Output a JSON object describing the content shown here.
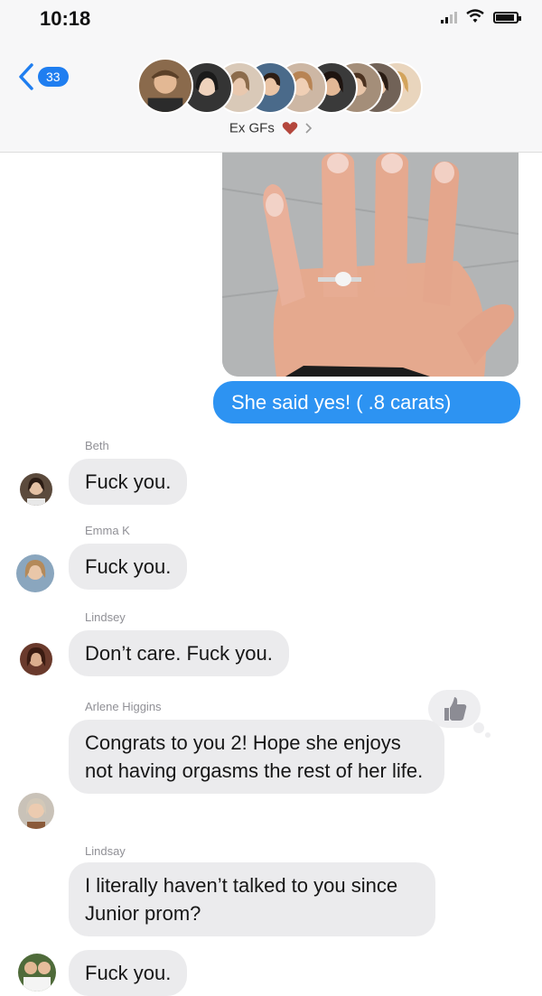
{
  "status": {
    "time": "10:18"
  },
  "header": {
    "back_count": "33",
    "group_name": "Ex GFs",
    "avatar_count": 9
  },
  "messages": {
    "outgoing_text": "She said yes! ( .8 carats)",
    "items": [
      {
        "sender": "Beth",
        "text": "Fuck you."
      },
      {
        "sender": "Emma K",
        "text": "Fuck you."
      },
      {
        "sender": "Lindsey",
        "text": "Don’t care. Fuck you."
      },
      {
        "sender": "Arlene  Higgins",
        "text": "Congrats to you 2! Hope she enjoys not having orgasms the rest of her life."
      },
      {
        "sender": "Lindsay",
        "text": "I literally haven’t talked to you since Junior prom?"
      },
      {
        "sender": "",
        "text": "Fuck you."
      }
    ]
  },
  "colors": {
    "outgoing_bubble": "#2d93f2",
    "incoming_bubble": "#ebebed",
    "accent": "#1f7ef0"
  },
  "icons": {
    "back": "chevron-left-icon",
    "heart": "heart-icon",
    "tapback": "thumbs-up-icon"
  }
}
